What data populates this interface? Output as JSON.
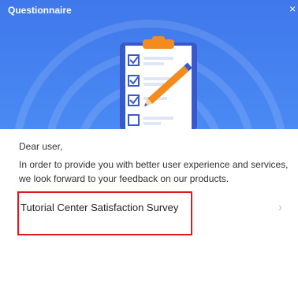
{
  "window": {
    "title": "Questionnaire",
    "close_glyph": "×"
  },
  "banner": {
    "icon": "clipboard-checklist-icon"
  },
  "content": {
    "greeting": "Dear user,",
    "message": "In order to provide you with better user experience and services, we look forward to your feedback on our products."
  },
  "survey": {
    "label": "Tutorial Center Satisfaction Survey",
    "chevron": "›"
  },
  "colors": {
    "header": "#4a8af4",
    "highlight": "#e2161d",
    "clip": "#f28c1e"
  }
}
